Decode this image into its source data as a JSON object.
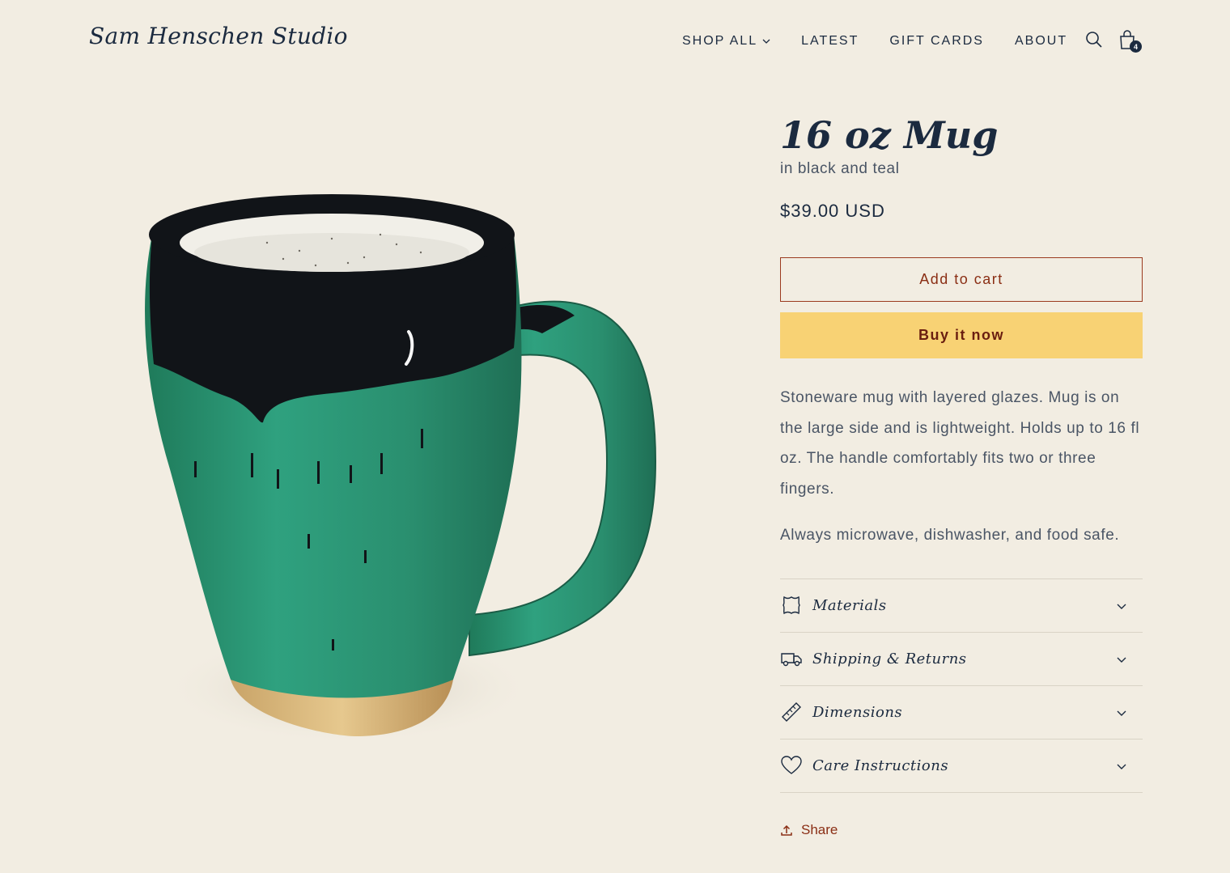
{
  "header": {
    "logo": "Sam Henschen Studio",
    "nav": [
      {
        "label": "SHOP ALL",
        "has_dropdown": true
      },
      {
        "label": "LATEST"
      },
      {
        "label": "GIFT CARDS"
      },
      {
        "label": "ABOUT"
      }
    ],
    "search_icon": "search-icon",
    "cart_icon": "cart-bag-icon",
    "cart_count": "4"
  },
  "product": {
    "image_icon": "mug-product-image",
    "title": "16 oz Mug",
    "subtitle": "in black and teal",
    "price": "$39.00 USD",
    "add_to_cart": "Add to cart",
    "buy_now": "Buy it now",
    "description": [
      "Stoneware mug with layered glazes. Mug is on the large side and is lightweight. Holds up to 16 fl oz. The handle comfortably fits two or three fingers.",
      "Always microwave, dishwasher, and food safe."
    ],
    "accordion": [
      {
        "label": "Materials",
        "icon": "leather-icon"
      },
      {
        "label": "Shipping & Returns",
        "icon": "truck-icon"
      },
      {
        "label": "Dimensions",
        "icon": "ruler-icon"
      },
      {
        "label": "Care Instructions",
        "icon": "heart-icon"
      }
    ],
    "share": "Share"
  },
  "colors": {
    "background": "#f2ede2",
    "text": "#1b2a3f",
    "accent": "#8a2e14",
    "buy_button": "#f8d274",
    "glaze_teal": "#2f8f73",
    "glaze_black": "#111418"
  }
}
